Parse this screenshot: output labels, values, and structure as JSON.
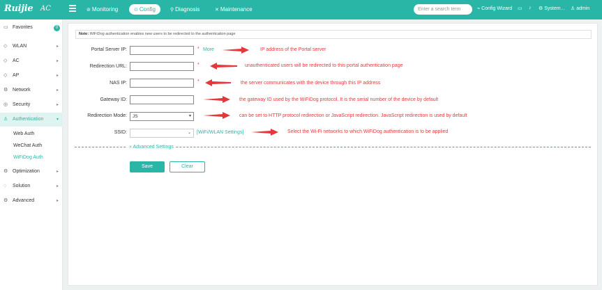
{
  "header": {
    "logo": "Ruijie",
    "product": "AC",
    "nav": [
      {
        "label": "Monitoring",
        "icon": "⊘"
      },
      {
        "label": "Config",
        "icon": "⊙"
      },
      {
        "label": "Diagnosis",
        "icon": "⚲"
      },
      {
        "label": "Maintenance",
        "icon": "✕"
      }
    ],
    "search_placeholder": "Enter a search term",
    "config_wizard": "Config Wizard",
    "system": "System...",
    "user": "admin"
  },
  "sidebar": {
    "items": [
      {
        "label": "Favorites",
        "badge": "0"
      },
      {
        "label": "WLAN"
      },
      {
        "label": "AC"
      },
      {
        "label": "AP"
      },
      {
        "label": "Network"
      },
      {
        "label": "Security"
      },
      {
        "label": "Authentication"
      },
      {
        "label": "Optimization"
      },
      {
        "label": "Solution"
      },
      {
        "label": "Advanced"
      }
    ],
    "auth_sub": [
      "Web Auth",
      "WeChat Auth",
      "WiFiDog Auth"
    ]
  },
  "note": {
    "label": "Note:",
    "text": "WiFiDog authentication enables new users to be redirected to the authentication page"
  },
  "form": {
    "portal_server_ip": {
      "label": "Portal Server IP:",
      "value": "",
      "required": "*",
      "more": "More"
    },
    "redirection_url": {
      "label": "Redirection URL:",
      "value": "",
      "required": "*"
    },
    "nas_ip": {
      "label": "NAS IP:",
      "value": "",
      "required": "*"
    },
    "gateway_id": {
      "label": "Gateway ID:",
      "value": ""
    },
    "redirection_mode": {
      "label": "Redirection Mode:",
      "value": "JS"
    },
    "ssid": {
      "label": "SSID:",
      "value": "",
      "settings_link": "[WiFi/WLAN Settings]"
    },
    "advanced": "Advanced Settings",
    "save": "Save",
    "clear": "Clear"
  },
  "annotations": {
    "portal_server_ip": "IP address of the Portal server",
    "redirection_url": "unauthenticated users will be redirected to this portal authentication page",
    "nas_ip": "the server communicates with the device through this IP address",
    "gateway_id": "the gateway ID used by the WiFiDog protocol. It is the serial number of the device by default",
    "redirection_mode": "can be set to HTTP protocol redirection or JavaScript redirection. JavaScript redirection is used by default",
    "ssid": "Select the Wi-Fi networks to which WiFiDog authentication is to be applied"
  },
  "colors": {
    "accent": "#2ab6a6",
    "annotation": "#e4393c"
  }
}
